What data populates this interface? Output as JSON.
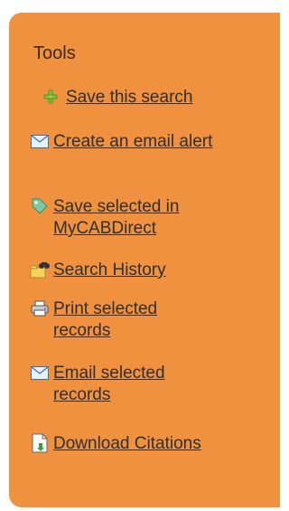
{
  "panel": {
    "title": "Tools"
  },
  "tools": [
    {
      "label": "Save this search",
      "icon": "plus-icon"
    },
    {
      "label": "Create an email alert",
      "icon": "envelope-icon"
    },
    {
      "label": "Save selected in MyCABDirect",
      "icon": "tag-icon"
    },
    {
      "label": "Search History",
      "icon": "folder-binoculars-icon"
    },
    {
      "label": "Print selected records",
      "icon": "printer-icon"
    },
    {
      "label": "Email selected records",
      "icon": "envelope-icon"
    },
    {
      "label": "Download Citations",
      "icon": "download-document-icon"
    }
  ],
  "colors": {
    "panel_background": "#f0913f",
    "text": "#2f2f2f"
  }
}
